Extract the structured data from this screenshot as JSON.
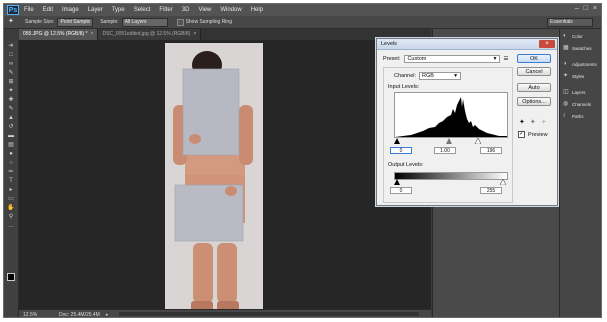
{
  "app": {
    "logo": "Ps"
  },
  "menubar": {
    "items": [
      "File",
      "Edit",
      "Image",
      "Layer",
      "Type",
      "Select",
      "Filter",
      "3D",
      "View",
      "Window",
      "Help"
    ]
  },
  "options_bar": {
    "sample_size_label": "Sample Size:",
    "sample_size_value": "Point Sample",
    "sample_label": "Sample:",
    "sample_value": "All Layers",
    "show_ring_label": "Show Sampling Ring",
    "workspace": "Essentials"
  },
  "tabs": [
    {
      "label": "055.JPG @ 12.5% (RGB/8) *",
      "active": true
    },
    {
      "label": "DSC_0051edited.jpg @ 12.5% (RGB/8)",
      "active": false
    }
  ],
  "status": {
    "zoom": "12.5%",
    "doc": "Doc: 25.4M/25.4M"
  },
  "right_panel": {
    "groups": [
      [
        "Color",
        "Swatches"
      ],
      [
        "Adjustments",
        "Styles"
      ],
      [
        "Layers",
        "Channels",
        "Paths"
      ]
    ]
  },
  "levels_dialog": {
    "title": "Levels",
    "preset_label": "Preset:",
    "preset_value": "Custom",
    "channel_label": "Channel:",
    "channel_value": "RGB",
    "input_levels_label": "Input Levels:",
    "input_black": "0",
    "input_gamma": "1.00",
    "input_white": "196",
    "output_levels_label": "Output Levels:",
    "output_black": "0",
    "output_white": "255",
    "buttons": {
      "ok": "OK",
      "cancel": "Cancel",
      "auto": "Auto",
      "options": "Options..."
    },
    "preview_label": "Preview",
    "preview_checked": true
  },
  "colors": {
    "accent": "#3a7bd5",
    "close": "#c94a3c"
  }
}
